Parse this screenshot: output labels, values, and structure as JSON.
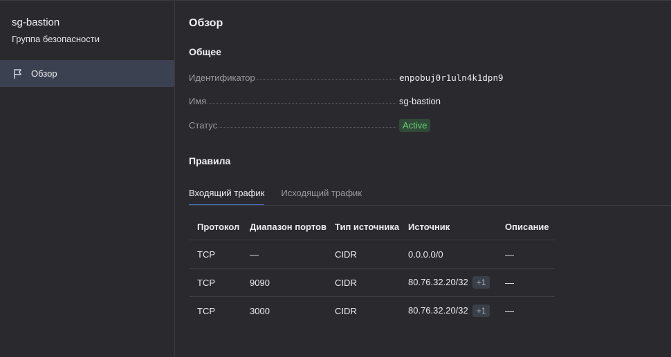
{
  "sidebar": {
    "title": "sg-bastion",
    "subtitle": "Группа безопасности",
    "items": [
      {
        "label": "Обзор",
        "icon": "flag-icon",
        "active": true
      }
    ]
  },
  "main": {
    "title": "Обзор",
    "general": {
      "heading": "Общее",
      "fields": [
        {
          "key": "Идентификатор",
          "value": "enpobuj0r1uln4k1dpn9"
        },
        {
          "key": "Имя",
          "value": "sg-bastion"
        },
        {
          "key": "Статус",
          "value": "Active"
        }
      ]
    },
    "rules": {
      "heading": "Правила",
      "tabs": [
        {
          "label": "Входящий трафик",
          "active": true
        },
        {
          "label": "Исходящий трафик",
          "active": false
        }
      ],
      "columns": [
        "Протокол",
        "Диапазон портов",
        "Тип источника",
        "Источник",
        "Описание"
      ],
      "rows": [
        {
          "protocol": "TCP",
          "ports": "—",
          "source_type": "CIDR",
          "source": "0.0.0.0/0",
          "extra": "",
          "description": "—"
        },
        {
          "protocol": "TCP",
          "ports": "9090",
          "source_type": "CIDR",
          "source": "80.76.32.20/32",
          "extra": "+1",
          "description": "—"
        },
        {
          "protocol": "TCP",
          "ports": "3000",
          "source_type": "CIDR",
          "source": "80.76.32.20/32",
          "extra": "+1",
          "description": "—"
        }
      ]
    }
  },
  "colors": {
    "background": "#2a2a2e",
    "sidebar_active": "#3b4150",
    "accent": "#4f7dd9",
    "status_active_bg": "#2f4a36",
    "status_active_text": "#6fcf7f"
  }
}
